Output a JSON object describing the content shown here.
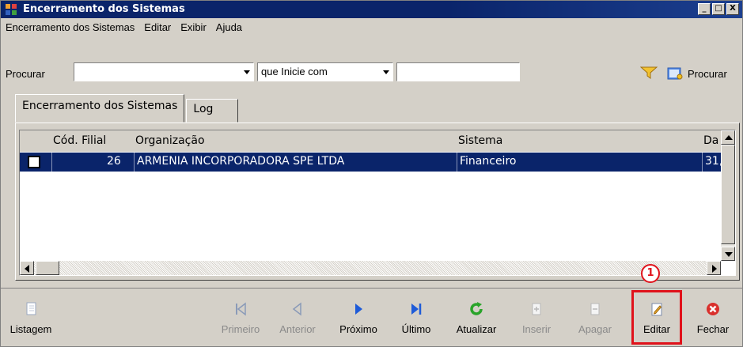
{
  "window": {
    "title": "Encerramento dos Sistemas",
    "controls": [
      "_",
      "□",
      "X"
    ]
  },
  "menu": [
    "Encerramento dos Sistemas",
    "Editar",
    "Exibir",
    "Ajuda"
  ],
  "search": {
    "label": "Procurar",
    "field_value": "",
    "mode_value": "que Inicie com",
    "text_value": "",
    "button_label": "Procurar"
  },
  "tabs": [
    {
      "label": "Encerramento dos Sistemas",
      "active": true
    },
    {
      "label": "Log",
      "active": false
    }
  ],
  "grid": {
    "columns": [
      "Cód. Filial",
      "Organização",
      "Sistema",
      "Da"
    ],
    "rows": [
      {
        "cod_filial": "26",
        "organizacao": "ARMENIA INCORPORADORA SPE LTDA",
        "sistema": "Financeiro",
        "data": "31,"
      }
    ]
  },
  "toolbar": [
    {
      "label": "Listagem",
      "enabled": true
    },
    {
      "label": "Primeiro",
      "enabled": false
    },
    {
      "label": "Anterior",
      "enabled": false
    },
    {
      "label": "Próximo",
      "enabled": true
    },
    {
      "label": "Último",
      "enabled": true
    },
    {
      "label": "Atualizar",
      "enabled": true
    },
    {
      "label": "Inserir",
      "enabled": false
    },
    {
      "label": "Apagar",
      "enabled": false
    },
    {
      "label": "Editar",
      "enabled": true
    },
    {
      "label": "Fechar",
      "enabled": true
    }
  ],
  "annotation": {
    "number": "1"
  },
  "colors": {
    "title_bar": "#0a246a",
    "selected_row": "#0a246a",
    "highlight": "#e0121b",
    "nav_blue": "#1e5bd8",
    "refresh_green": "#2aa42a",
    "close_red": "#d9302c"
  }
}
